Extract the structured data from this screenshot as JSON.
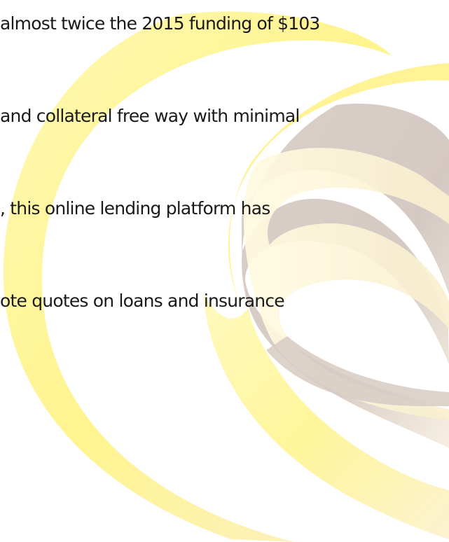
{
  "slide": {
    "lines": [
      "almost twice the 2015 funding of $103",
      "and collateral free way with minimal",
      ", this online lending platform has",
      "ote quotes on loans and insurance"
    ]
  },
  "colors": {
    "swirl_yellow": "#fff27a",
    "swirl_pale": "#fdf6c6",
    "swirl_taupe": "#d4c7c1",
    "text": "#1a1a1a"
  }
}
